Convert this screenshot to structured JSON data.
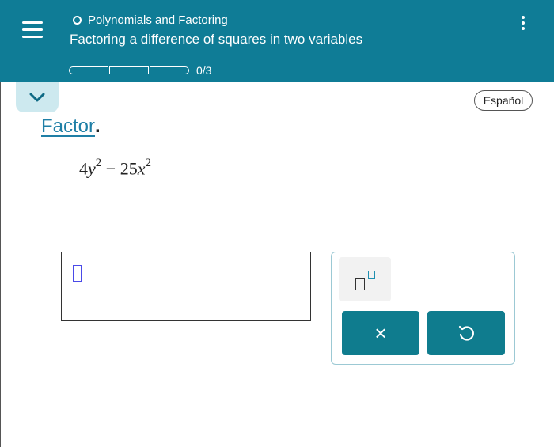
{
  "header": {
    "topic": "Polynomials and Factoring",
    "lesson_title": "Factoring a difference of squares in two variables",
    "progress_text": "0/3",
    "progress_segments": 3,
    "progress_filled": 0,
    "menu_icon": "hamburger-menu-icon",
    "more_icon": "kebab-menu-icon"
  },
  "language_button": "Español",
  "instruction": {
    "word": "Factor",
    "period": "."
  },
  "expression": {
    "coef1": "4",
    "var1": "y",
    "exp1": "2",
    "minus": "−",
    "coef2": "25",
    "var2": "x",
    "exp2": "2"
  },
  "keypad": {
    "power_button_icon": "superscript-template-icon",
    "clear_button_glyph": "×",
    "undo_button_glyph": "↺"
  },
  "colors": {
    "header_bg": "#0f7c96",
    "button_bg": "#0f7c8e",
    "link": "#1f7fa6",
    "caret": "#4a4ae8"
  }
}
